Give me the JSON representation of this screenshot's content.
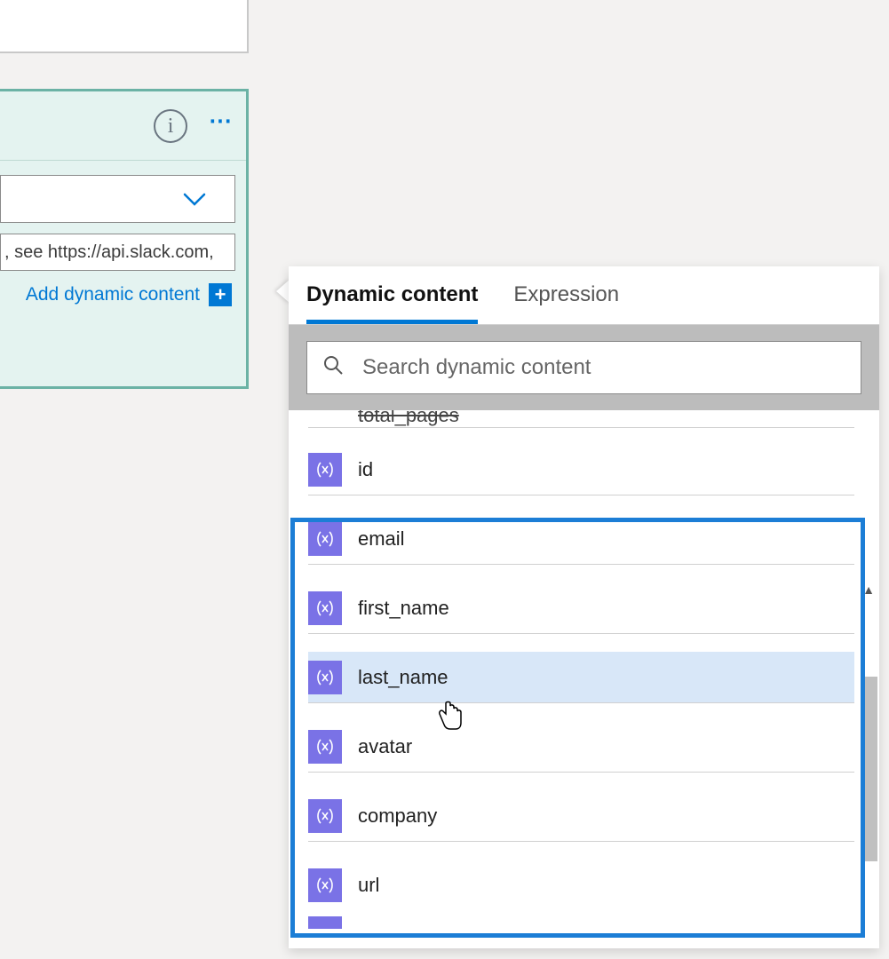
{
  "action_card": {
    "text_field_value": ", see https://api.slack.com,",
    "add_dynamic_label": "Add dynamic content"
  },
  "popout": {
    "tabs": {
      "dynamic": "Dynamic content",
      "expression": "Expression"
    },
    "search_placeholder": "Search dynamic content",
    "items_clipped_top": "total_pages",
    "items": [
      "id",
      "email",
      "first_name",
      "last_name",
      "avatar",
      "company",
      "url"
    ]
  }
}
